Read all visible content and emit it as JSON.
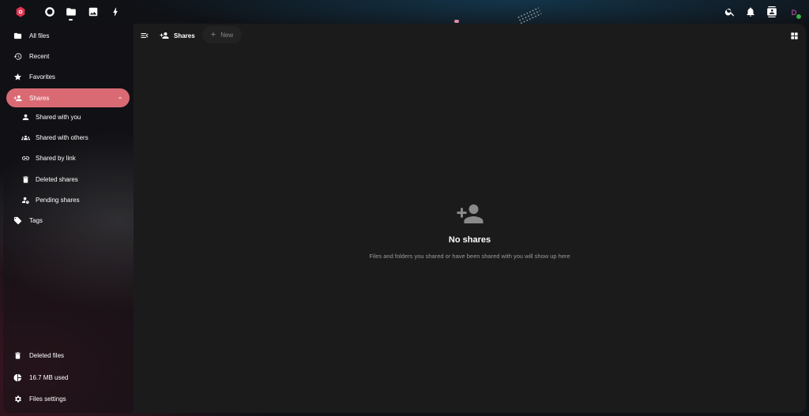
{
  "header": {
    "apps": [
      {
        "name": "dashboard-icon"
      },
      {
        "name": "files-icon",
        "active": true
      },
      {
        "name": "photos-icon"
      },
      {
        "name": "activity-icon"
      }
    ],
    "right": [
      "search-icon",
      "notifications-icon",
      "contacts-icon"
    ],
    "avatar_initial": "D"
  },
  "sidebar": {
    "items": [
      {
        "label": "All files",
        "icon": "folder-icon"
      },
      {
        "label": "Recent",
        "icon": "history-icon"
      },
      {
        "label": "Favorites",
        "icon": "star-icon"
      },
      {
        "label": "Shares",
        "icon": "share-icon",
        "active": true,
        "expanded": true
      },
      {
        "label": "Shared with you",
        "icon": "person-icon"
      },
      {
        "label": "Shared with others",
        "icon": "group-icon"
      },
      {
        "label": "Shared by link",
        "icon": "link-icon"
      },
      {
        "label": "Deleted shares",
        "icon": "trash-icon"
      },
      {
        "label": "Pending shares",
        "icon": "pending-share-icon"
      },
      {
        "label": "Tags",
        "icon": "tag-icon"
      }
    ],
    "footer": [
      {
        "label": "Deleted files",
        "icon": "trash-icon"
      },
      {
        "label": "16.7 MB used",
        "icon": "pie-chart-icon"
      },
      {
        "label": "Files settings",
        "icon": "gear-icon"
      }
    ]
  },
  "toolbar": {
    "breadcrumb": "Shares",
    "new_label": "New"
  },
  "empty_state": {
    "title": "No shares",
    "description": "Files and folders you shared or have been shared with you will show up here"
  },
  "colors": {
    "accent": "#d96a73",
    "status_online": "#37b04a",
    "content_bg": "#1b1b1b"
  }
}
